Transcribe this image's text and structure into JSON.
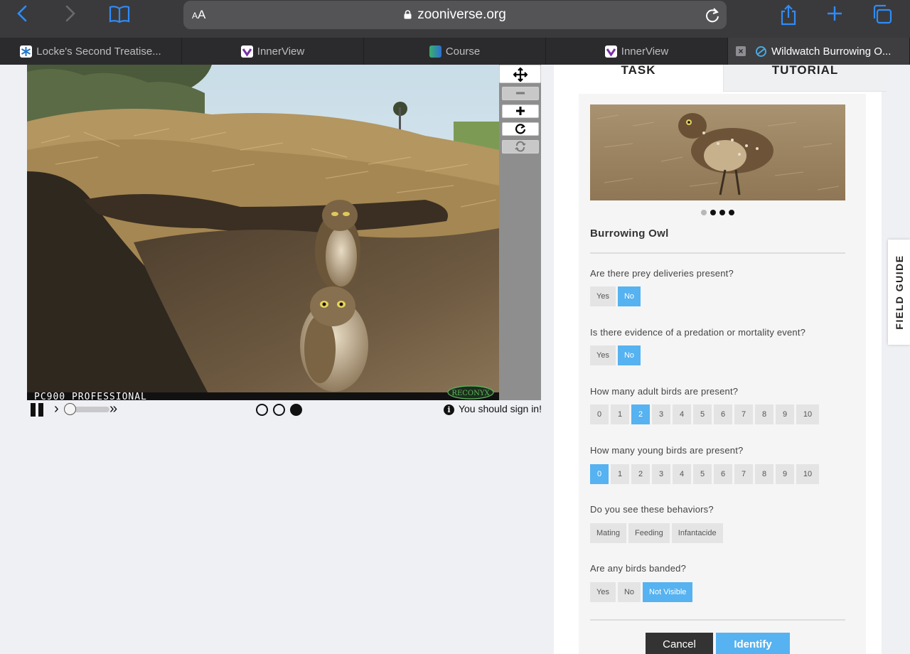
{
  "browser": {
    "font_size_label": "AA",
    "url": "zooniverse.org",
    "accent": "#2f8cf7"
  },
  "tabs": [
    {
      "label": "Locke's Second Treatise...",
      "favicon": "snowflake-icon"
    },
    {
      "label": "InnerView",
      "favicon": "innerview-logo-icon"
    },
    {
      "label": "Course",
      "favicon": "course-gradient-icon"
    },
    {
      "label": "InnerView",
      "favicon": "innerview-logo-icon"
    },
    {
      "label": "Wildwatch Burrowing O...",
      "favicon": "zooniverse-icon",
      "active": true
    }
  ],
  "viewer": {
    "camera_overlay": "PC900 PROFESSIONAL",
    "camera_brand": "RECONYX",
    "tools": [
      "move-icon",
      "zoom-out-icon",
      "zoom-in-icon",
      "rotate-icon",
      "reset-icon"
    ],
    "frames_total": 3,
    "current_frame": 3,
    "signin_text": "You should sign in!"
  },
  "panel": {
    "tab_task": "TASK",
    "tab_tutorial": "TUTORIAL",
    "species_name": "Burrowing Owl",
    "carousel_total": 4,
    "carousel_active": 1,
    "questions": [
      {
        "text": "Are there prey deliveries present?",
        "options": [
          "Yes",
          "No"
        ],
        "selected": "No"
      },
      {
        "text": "Is there evidence of a predation or mortality event?",
        "options": [
          "Yes",
          "No"
        ],
        "selected": "No"
      },
      {
        "text": "How many adult birds are present?",
        "options": [
          "0",
          "1",
          "2",
          "3",
          "4",
          "5",
          "6",
          "7",
          "8",
          "9",
          "10"
        ],
        "selected": "2"
      },
      {
        "text": "How many young birds are present?",
        "options": [
          "0",
          "1",
          "2",
          "3",
          "4",
          "5",
          "6",
          "7",
          "8",
          "9",
          "10"
        ],
        "selected": "0"
      },
      {
        "text": "Do you see these behaviors?",
        "options": [
          "Mating",
          "Feeding",
          "Infantacide"
        ],
        "selected": null
      },
      {
        "text": "Are any birds banded?",
        "options": [
          "Yes",
          "No",
          "Not Visible"
        ],
        "selected": "Not Visible"
      }
    ],
    "cancel_label": "Cancel",
    "identify_label": "Identify",
    "selected_color": "#56b2f0"
  },
  "field_guide_label": "FIELD GUIDE"
}
